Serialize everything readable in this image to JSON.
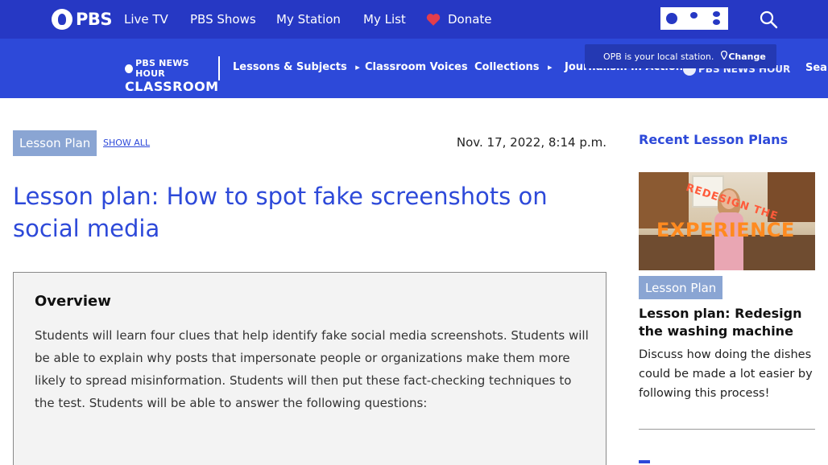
{
  "topbar": {
    "brand": "PBS",
    "nav": [
      "Live TV",
      "PBS Shows",
      "My Station",
      "My List"
    ],
    "donate_label": "Donate",
    "station_logo_text": "OPB",
    "colors": {
      "bar": "#2638c4",
      "heart": "#e33d4b"
    }
  },
  "subbar": {
    "logo_line1": "PBS NEWS HOUR",
    "logo_line2": "CLASSROOM",
    "nav": [
      {
        "label": "Lessons & Subjects",
        "has_arrow": true
      },
      {
        "label": "Classroom Voices",
        "has_arrow": false
      },
      {
        "label": "Collections",
        "has_arrow": true
      },
      {
        "label": "Journalism in Action",
        "has_arrow": false
      }
    ],
    "arrow_glyph": "▸",
    "station_popup": {
      "text": "OPB is your local station.",
      "change_label": "Change"
    },
    "right_logo_text": "PBS NEWS HOUR",
    "search_label": "Sear"
  },
  "article": {
    "category": "Lesson Plan",
    "show_all": "SHOW ALL",
    "date": "Nov. 17, 2022, 8:14 p.m.",
    "title": "Lesson plan: How to spot fake screenshots on social media",
    "overview_heading": "Overview",
    "overview_text": "Students will learn four clues that help identify fake social media screenshots. Students will be able to explain why posts that impersonate people or organizations make them more likely to spread misinformation. Students will then put these fact-checking techniques to the test. Students will be able to answer the following questions:"
  },
  "sidebar": {
    "heading": "Recent Lesson Plans",
    "card": {
      "image_text_1": "REDESIGN THE",
      "image_text_2": "EXPERIENCE",
      "category": "Lesson Plan",
      "title": "Lesson plan: Redesign the washing machine",
      "description": "Discuss how doing the dishes could be made a lot easier by following this process!"
    }
  }
}
